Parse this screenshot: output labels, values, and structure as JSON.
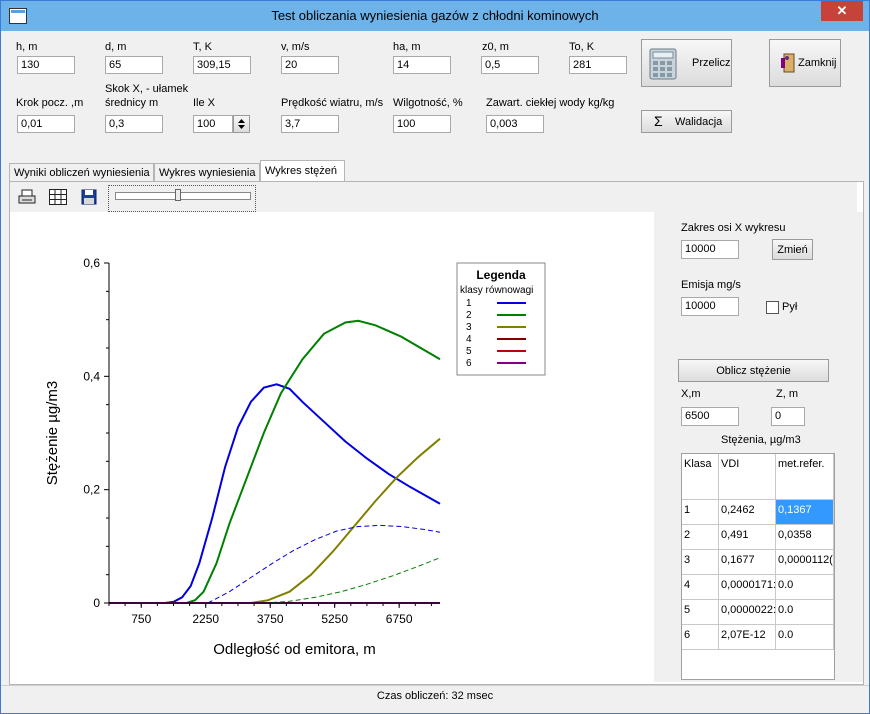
{
  "window": {
    "title": "Test obliczania wyniesienia gazów z chłodni kominowych",
    "close_glyph": "✕"
  },
  "params_row1": [
    {
      "key": "h",
      "label": "h, m",
      "value": "130"
    },
    {
      "key": "d",
      "label": "d, m",
      "value": "65"
    },
    {
      "key": "T",
      "label": "T, K",
      "value": "309,15"
    },
    {
      "key": "v",
      "label": "v, m/s",
      "value": "20"
    },
    {
      "key": "ha",
      "label": "ha, m",
      "value": "14"
    },
    {
      "key": "z0",
      "label": "z0, m",
      "value": "0,5"
    },
    {
      "key": "To",
      "label": "To, K",
      "value": "281"
    }
  ],
  "params_row2": {
    "krok_label": "Krok pocz. ,m",
    "krok_value": "0,01",
    "skok_label_1": "Skok  X,  - ułamek",
    "skok_label_2": "średnicy m",
    "skok_value": "0,3",
    "ilex_label": "Ile X",
    "ilex_value": "100",
    "wiatr_label": "Prędkość wiatru, m/s",
    "wiatr_value": "3,7",
    "wilg_label": "Wilgotność, %",
    "wilg_value": "100",
    "woda_label": "Zawart. ciekłej wody kg/kg",
    "woda_value": "0,003"
  },
  "buttons": {
    "przelicz": "Przelicz",
    "zamknij": "Zamknij",
    "walidacja": "Walidacja",
    "walidacja_icon": "Σ"
  },
  "tabs": [
    {
      "label": "Wyniki obliczeń wyniesienia"
    },
    {
      "label": "Wykres wyniesienia"
    },
    {
      "label": "Wykres stężeń"
    }
  ],
  "right_panel": {
    "zakres_label": "Zakres osi X wykresu",
    "zakres_value": "10000",
    "zmien": "Zmień",
    "emisja_label": "Emisja mg/s",
    "emisja_value": "10000",
    "pyl_label": "Pył",
    "oblicz": "Oblicz stężenie",
    "x_label": "X,m",
    "x_value": "6500",
    "z_label": "Z, m",
    "z_value": "0",
    "table_title": "Stężenia, µg/m3",
    "columns": [
      "Klasa",
      "VDI",
      "met.refer."
    ],
    "rows": [
      [
        "1",
        "0,2462",
        "0,1367"
      ],
      [
        "2",
        "0,491",
        "0,0358"
      ],
      [
        "3",
        "0,1677",
        "0,0000112("
      ],
      [
        "4",
        "0,0000171:",
        "0.0"
      ],
      [
        "5",
        "0,0000022:",
        "0.0"
      ],
      [
        "6",
        "2,07E-12",
        "0.0"
      ]
    ]
  },
  "status": "Czas obliczeń: 32 msec",
  "colors": {
    "c1": "#0000e0",
    "c2": "#008000",
    "c3": "#808000",
    "c4": "#800000",
    "c5": "#c00000",
    "c6": "#800080",
    "selected": "#3399ff"
  },
  "chart_data": {
    "type": "line",
    "xlabel": "Odległość od emitora, m",
    "ylabel": "Stężenie µg/m3",
    "xlim": [
      0,
      7700
    ],
    "ylim": [
      0,
      0.6
    ],
    "xticks": [
      750,
      2250,
      3750,
      5250,
      6750
    ],
    "yticks": [
      {
        "v": 0,
        "label": "0"
      },
      {
        "v": 0.2,
        "label": "0,2"
      },
      {
        "v": 0.4,
        "label": "0,4"
      },
      {
        "v": 0.6,
        "label": "0,6"
      }
    ],
    "legend_title": "Legenda",
    "legend_subtitle": "klasy równowagi",
    "series": [
      {
        "name": "1",
        "color": "#0000e0",
        "dashed": false,
        "x": [
          0,
          1300,
          1500,
          1700,
          1900,
          2100,
          2400,
          2700,
          3000,
          3300,
          3600,
          3900,
          4200,
          4500,
          5000,
          5500,
          6000,
          6500,
          7000,
          7700
        ],
        "y": [
          0,
          0,
          0.002,
          0.01,
          0.03,
          0.07,
          0.15,
          0.24,
          0.31,
          0.355,
          0.38,
          0.386,
          0.378,
          0.355,
          0.32,
          0.285,
          0.255,
          0.228,
          0.205,
          0.175
        ]
      },
      {
        "name": "2",
        "color": "#008000",
        "dashed": false,
        "x": [
          0,
          1800,
          2000,
          2200,
          2500,
          2800,
          3200,
          3600,
          4000,
          4500,
          5000,
          5500,
          5800,
          6200,
          6800,
          7700
        ],
        "y": [
          0,
          0,
          0.005,
          0.02,
          0.07,
          0.14,
          0.22,
          0.3,
          0.37,
          0.43,
          0.475,
          0.495,
          0.498,
          0.49,
          0.47,
          0.43
        ]
      },
      {
        "name": "3",
        "color": "#808000",
        "dashed": false,
        "x": [
          0,
          3300,
          3700,
          4200,
          4700,
          5200,
          5700,
          6200,
          6700,
          7200,
          7700
        ],
        "y": [
          0,
          0,
          0.005,
          0.02,
          0.05,
          0.09,
          0.135,
          0.18,
          0.222,
          0.258,
          0.29
        ]
      },
      {
        "name": "4",
        "color": "#800000",
        "dashed": false,
        "x": [
          0,
          7700
        ],
        "y": [
          0,
          0
        ]
      },
      {
        "name": "5",
        "color": "#c00000",
        "dashed": false,
        "x": [
          0,
          7700
        ],
        "y": [
          0,
          0
        ]
      },
      {
        "name": "6",
        "color": "#800080",
        "dashed": false,
        "x": [
          0,
          7700
        ],
        "y": [
          0,
          0
        ]
      },
      {
        "name": "",
        "color": "#0000e0",
        "dashed": true,
        "x": [
          2300,
          2800,
          3300,
          3800,
          4300,
          4800,
          5300,
          5800,
          6300,
          6800,
          7300,
          7700
        ],
        "y": [
          0,
          0.02,
          0.045,
          0.07,
          0.093,
          0.112,
          0.127,
          0.135,
          0.137,
          0.135,
          0.13,
          0.125
        ]
      },
      {
        "name": "",
        "color": "#008000",
        "dashed": true,
        "x": [
          3600,
          4200,
          4800,
          5400,
          6000,
          6600,
          7200,
          7700
        ],
        "y": [
          0,
          0.003,
          0.01,
          0.02,
          0.033,
          0.048,
          0.065,
          0.08
        ]
      }
    ]
  }
}
